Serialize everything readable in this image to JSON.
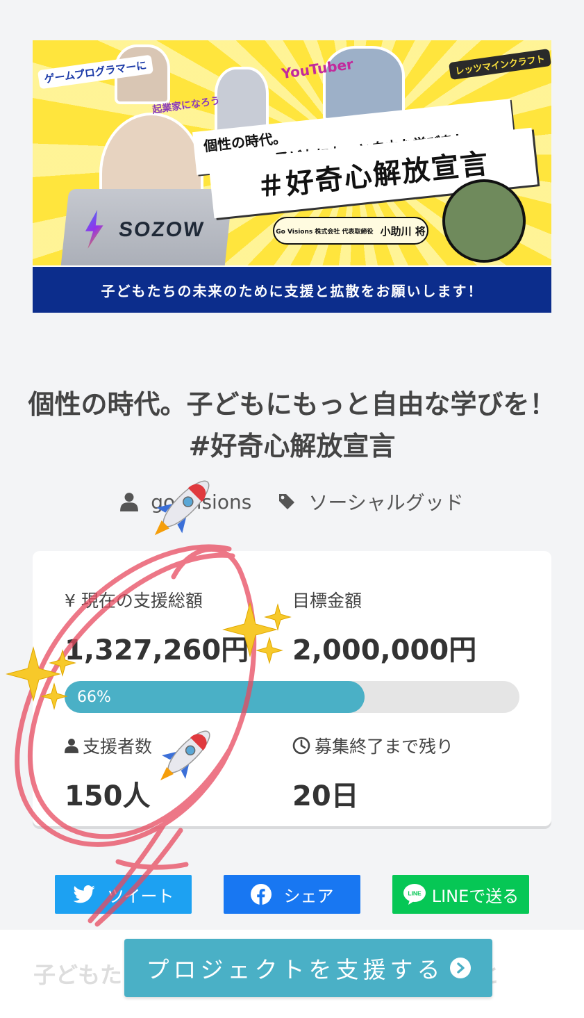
{
  "banner": {
    "tag_game": "ゲームプログラマーに",
    "tag_youtuber": "YouTuber",
    "tag_kigyo": "起業家になろう",
    "tag_mine": "レッツマインクラフト",
    "logo_text": "SOZOW",
    "headline_1": "個性の時代。",
    "headline_2": "子どもにもっと自由な学びを！",
    "headline_main": "＃好奇心解放宣言",
    "ceo_company": "Go Visions 株式会社 代表取締役",
    "ceo_name": "小助川 将",
    "strip_text": "子どもたちの未来のために支援と拡散をお願いします！"
  },
  "project": {
    "title": "個性の時代。子どもにもっと自由な学びを！#好奇心解放宣言",
    "author": "go_visions",
    "category": "ソーシャルグッド"
  },
  "stats": {
    "current_label": "¥ 現在の支援総額",
    "current_value": "1,327,260円",
    "goal_label": "目標金額",
    "goal_value": "2,000,000円",
    "progress_percent": 66,
    "progress_text": "66%",
    "backers_label": "支援者数",
    "backers_value": "150人",
    "remaining_label": "募集終了まで残り",
    "remaining_value": "20日"
  },
  "share": {
    "tweet": "ツイート",
    "facebook": "シェア",
    "line": "LINEで送る",
    "line_badge": "LINE"
  },
  "cta": {
    "support_label": "プロジェクトを支援する"
  },
  "behind_text": "子どもたちの未来のために私たちができること",
  "colors": {
    "accent": "#4ab0c6",
    "twitter": "#1da1f2",
    "facebook": "#1877f2",
    "line": "#06c755",
    "banner_blue": "#0c2d8c",
    "banner_yellow": "#ffe53d"
  }
}
